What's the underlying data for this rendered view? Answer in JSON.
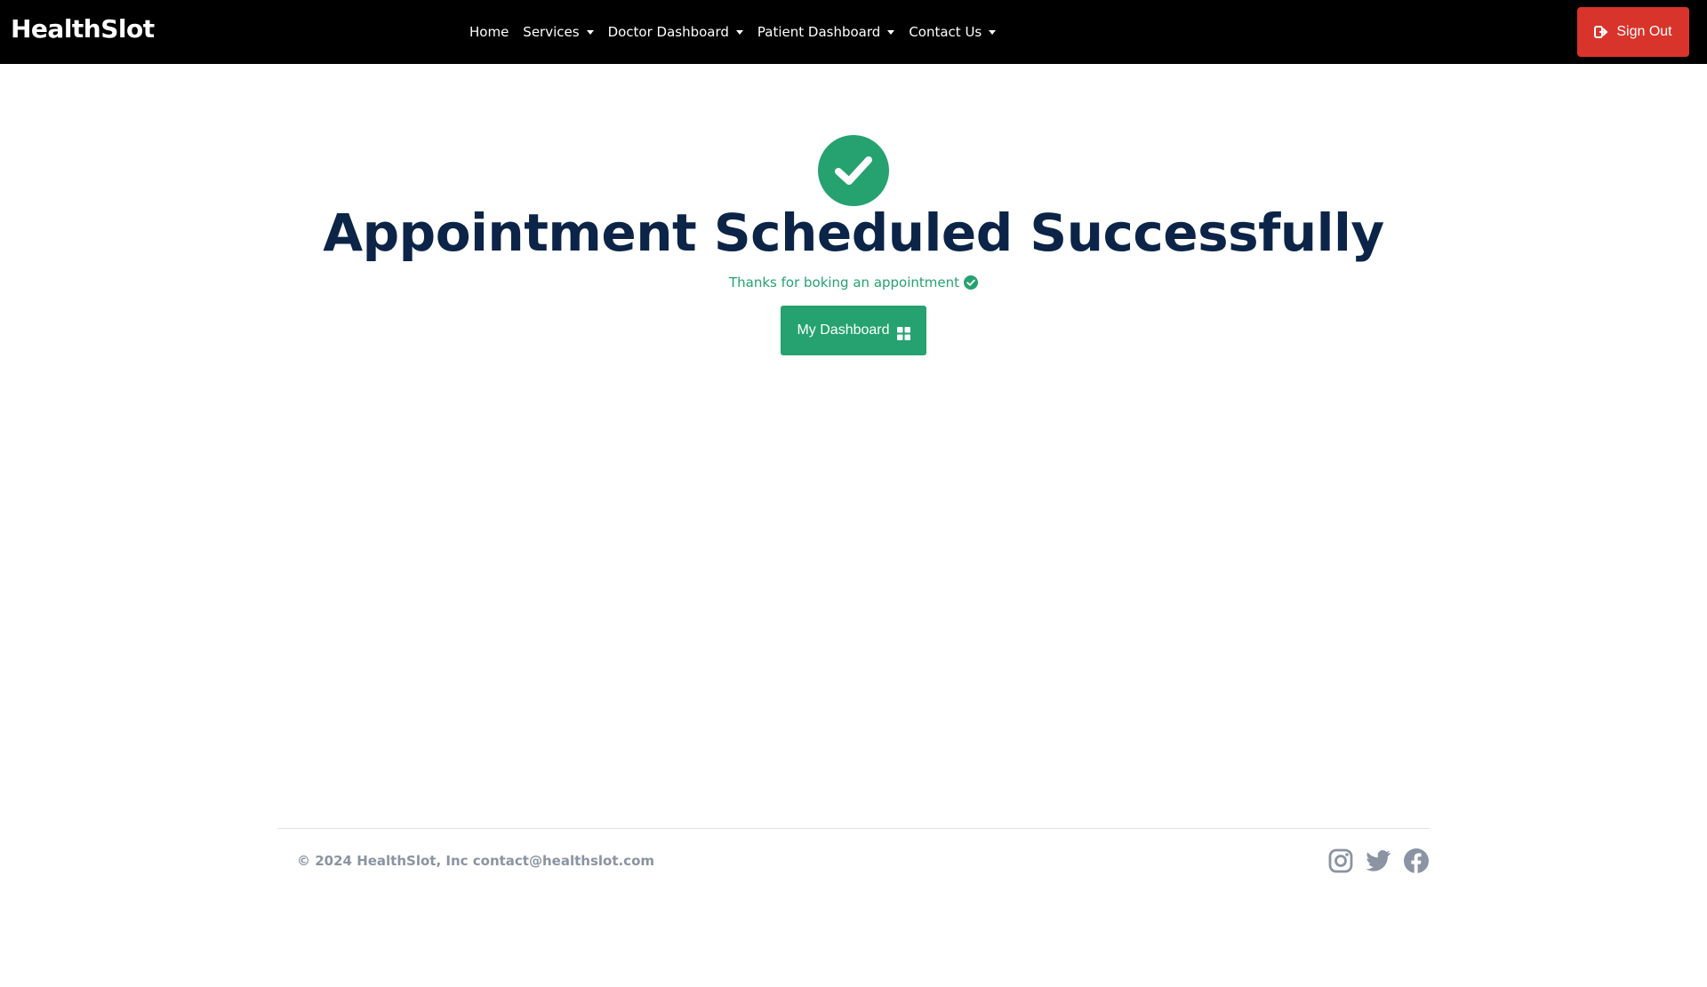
{
  "navbar": {
    "brand": "HealthSlot",
    "links": [
      {
        "label": "Home"
      },
      {
        "label": "Services"
      },
      {
        "label": "Doctor Dashboard"
      },
      {
        "label": "Patient Dashboard"
      },
      {
        "label": "Contact Us"
      }
    ],
    "sign_out_label": "Sign Out"
  },
  "main": {
    "title": "Appointment Scheduled Successfully",
    "subtitle": "Thanks for boking an appointment",
    "dashboard_button_label": "My Dashboard"
  },
  "footer": {
    "copyright": "© 2024 HealthSlot, Inc contact@healthslot.com",
    "social_icons": [
      "instagram-icon",
      "twitter-icon",
      "facebook-icon"
    ]
  },
  "colors": {
    "navbar_bg": "#000000",
    "accent_green": "#25a26f",
    "sign_out_red": "#d8342c",
    "title_navy": "#0b2447",
    "footer_gray": "#8a94a3"
  }
}
